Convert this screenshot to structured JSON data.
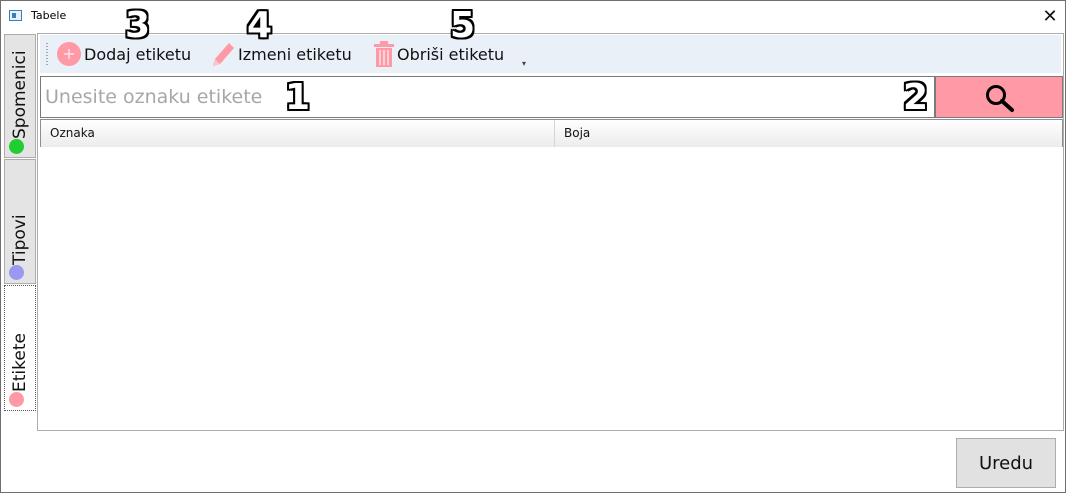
{
  "window": {
    "title": "Tabele",
    "close_glyph": "✕"
  },
  "tabs": [
    {
      "label": "Spomenici",
      "dot_color": "#22cc33"
    },
    {
      "label": "Tipovi",
      "dot_color": "#9b97f3"
    },
    {
      "label": "Etikete",
      "dot_color": "#ff99a6",
      "active": true
    }
  ],
  "toolbar": {
    "add_label": "Dodaj etiketu",
    "add_icon": "plus-circle-icon",
    "edit_label": "Izmeni etiketu",
    "edit_icon": "pencil-icon",
    "delete_label": "Obriši etiketu",
    "delete_icon": "trash-icon",
    "overflow_glyph": "▾"
  },
  "search": {
    "placeholder": "Unesite oznaku etikete",
    "value": "",
    "button_icon": "search-icon"
  },
  "table": {
    "columns": [
      "Oznaka",
      "Boja"
    ],
    "rows": []
  },
  "annotations": [
    "1",
    "2",
    "3",
    "4",
    "5"
  ],
  "footer": {
    "ok_label": "Uredu"
  },
  "colors": {
    "accent": "#ff99a6",
    "toolbar_bg": "#e9f0f8"
  }
}
